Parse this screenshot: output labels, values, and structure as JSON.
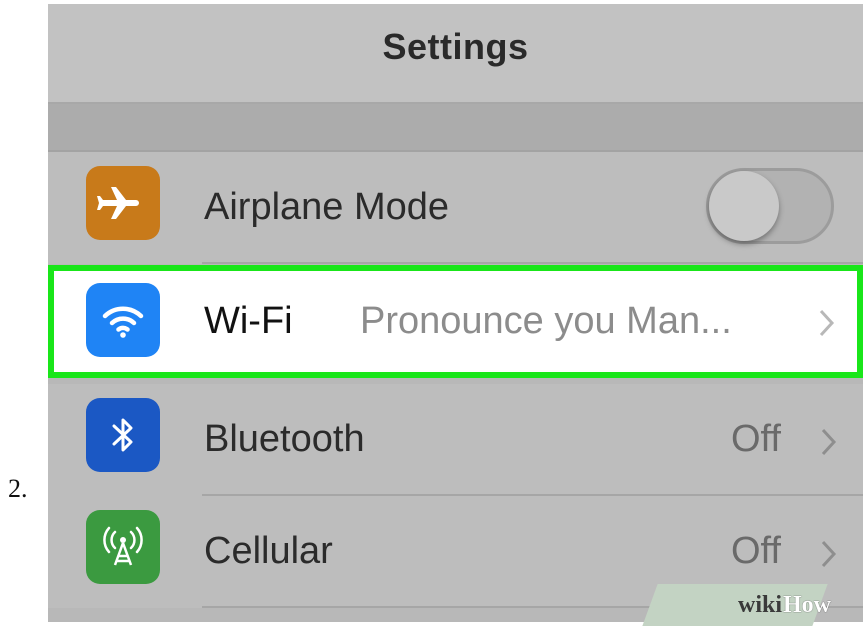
{
  "step": {
    "number": "2."
  },
  "nav": {
    "title": "Settings"
  },
  "rows": [
    {
      "id": "airplane",
      "label": "Airplane Mode",
      "icon": "airplane-icon",
      "color": "#c87a1a",
      "toggle": "off"
    },
    {
      "id": "wifi",
      "label": "Wi-Fi",
      "value": "Pronounce you Man...",
      "icon": "wifi-icon",
      "color": "#1f84f5",
      "highlighted": true,
      "highlight_color": "#19e619"
    },
    {
      "id": "bluetooth",
      "label": "Bluetooth",
      "value": "Off",
      "icon": "bluetooth-icon",
      "color": "#1b58c4"
    },
    {
      "id": "cellular",
      "label": "Cellular",
      "value": "Off",
      "icon": "cellular-antenna-icon",
      "color": "#3b9a40"
    }
  ],
  "watermark": {
    "part1": "wiki",
    "part2": "How"
  }
}
